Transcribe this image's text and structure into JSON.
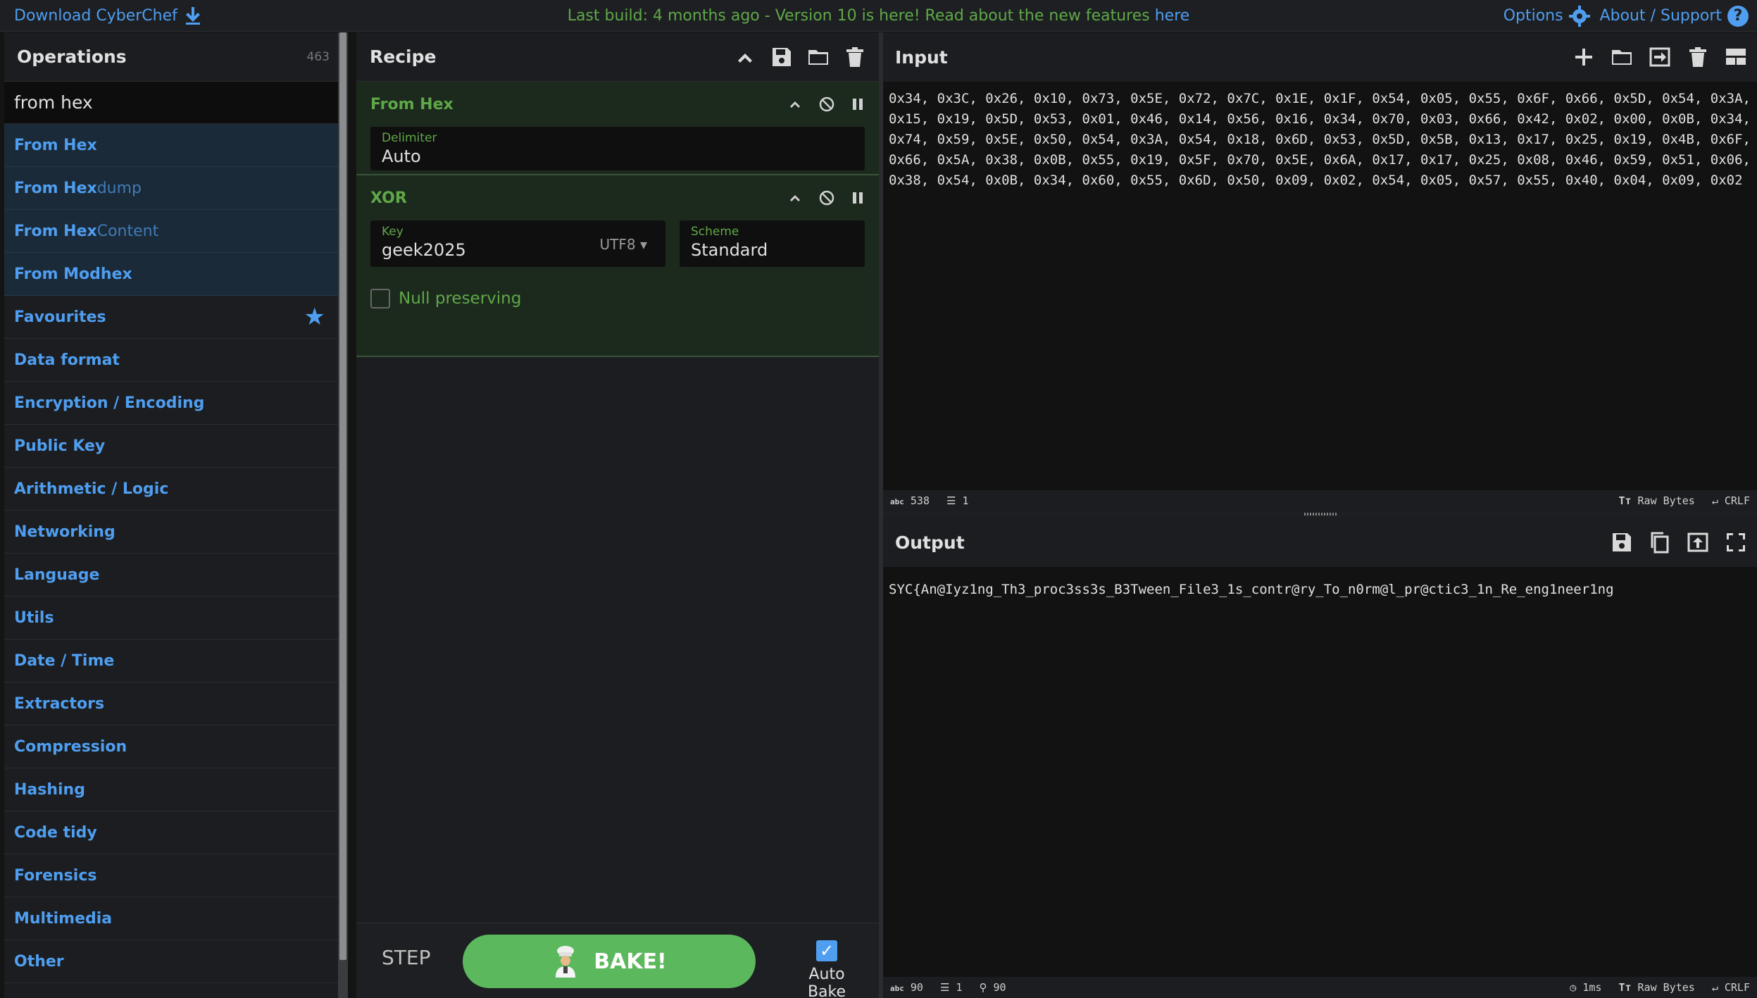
{
  "banner": {
    "download_label": "Download CyberChef",
    "build_text": "Last build: 4 months ago",
    "separator": " - ",
    "version_text": "Version 10 is here! Read about the new features ",
    "here_link": "here",
    "options_label": "Options",
    "about_label": "About / Support"
  },
  "operations": {
    "title": "Operations",
    "count": "463",
    "search_value": "from hex",
    "results": [
      {
        "match": "From Hex",
        "rest": ""
      },
      {
        "match": "From Hex",
        "rest": "dump"
      },
      {
        "match": "From Hex",
        "rest": " Content"
      },
      {
        "match": "From Modhex",
        "rest": ""
      }
    ],
    "categories": [
      "Favourites",
      "Data format",
      "Encryption / Encoding",
      "Public Key",
      "Arithmetic / Logic",
      "Networking",
      "Language",
      "Utils",
      "Date / Time",
      "Extractors",
      "Compression",
      "Hashing",
      "Code tidy",
      "Forensics",
      "Multimedia",
      "Other"
    ]
  },
  "recipe": {
    "title": "Recipe",
    "ops": [
      {
        "name": "From Hex",
        "fields": [
          {
            "label": "Delimiter",
            "value": "Auto"
          }
        ]
      },
      {
        "name": "XOR",
        "key_label": "Key",
        "key_value": "geek2025",
        "key_encoding": "UTF8",
        "scheme_label": "Scheme",
        "scheme_value": "Standard",
        "null_preserving": "Null preserving"
      }
    ],
    "step_label": "STEP",
    "bake_label": "BAKE!",
    "autobake_label": "Auto Bake"
  },
  "input": {
    "title": "Input",
    "text": "0x34, 0x3C, 0x26, 0x10, 0x73, 0x5E, 0x72, 0x7C, 0x1E, 0x1F, 0x54, 0x05, 0x55, 0x6F, 0x66, 0x5D, 0x54, 0x3A, 0x15, 0x19, 0x5D, 0x53, 0x01, 0x46, 0x14, 0x56, 0x16, 0x34, 0x70, 0x03, 0x66, 0x42, 0x02, 0x00, 0x0B, 0x34, 0x74, 0x59, 0x5E, 0x50, 0x54, 0x3A, 0x54, 0x18, 0x6D, 0x53, 0x5D, 0x5B, 0x13, 0x17, 0x25, 0x19, 0x4B, 0x6F, 0x66, 0x5A, 0x38, 0x0B, 0x55, 0x19, 0x5F, 0x70, 0x5E, 0x6A, 0x17, 0x17, 0x25, 0x08, 0x46, 0x59, 0x51, 0x06, 0x38, 0x54, 0x0B, 0x34, 0x60, 0x55, 0x6D, 0x50, 0x09, 0x02, 0x54, 0x05, 0x57, 0x55, 0x40, 0x04, 0x09, 0x02",
    "status_chars": "538",
    "status_lines": "1",
    "raw_bytes": "Raw Bytes",
    "eol": "CRLF"
  },
  "output": {
    "title": "Output",
    "text": "SYC{An@Iyz1ng_Th3_proc3ss3s_B3Tween_File3_1s_contr@ry_To_n0rm@l_pr@ctic3_1n_Re_eng1neer1ng",
    "status_chars": "90",
    "status_lines": "1",
    "status_pos": "90",
    "time": "1ms",
    "raw_bytes": "Raw Bytes",
    "eol": "CRLF"
  },
  "colors": {
    "accent_blue": "#4f9ef0",
    "accent_green": "#5fa848",
    "bake_green": "#5cb85c"
  }
}
